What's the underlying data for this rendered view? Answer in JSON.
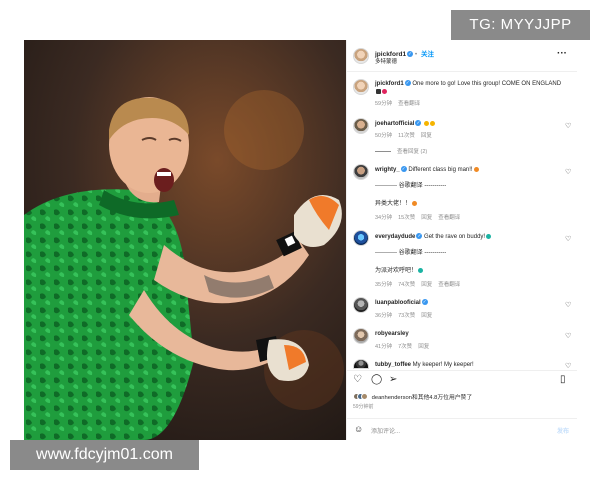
{
  "watermarks": {
    "top": "TG: MYYJJPP",
    "bottom": "www.fdcyjm01.com"
  },
  "post": {
    "author": "jpickford1",
    "follow_label": "关注",
    "subtitle": "多特蒙德",
    "more_icon": "more-horizontal-icon",
    "caption": "One more to go! Love this group! COME ON ENGLAND",
    "caption_time": "59分钟",
    "caption_translate": "查看翻译"
  },
  "comments": [
    {
      "user": "joehartofficial",
      "verified": true,
      "text": "",
      "time": "50分钟",
      "likes": "11次赞",
      "reply": "回复",
      "replies": "查看回复 (2)"
    },
    {
      "user": "wrighty_",
      "verified": true,
      "text": "Different class big man!!",
      "translate_header": "----------- 谷歌翻译 -----------",
      "translation": "异类大佬！！",
      "time": "34分钟",
      "likes": "15次赞",
      "reply": "回复",
      "translate": "查看翻译"
    },
    {
      "user": "everydaydude",
      "verified": true,
      "text": "Get the rave on buddy!",
      "translate_header": "----------- 谷歌翻译 -----------",
      "translation": "为派对欢呼吧！",
      "time": "35分钟",
      "likes": "74次赞",
      "reply": "回复",
      "translate": "查看翻译"
    },
    {
      "user": "luanpablooficial",
      "verified": true,
      "text": "",
      "time": "36分钟",
      "likes": "73次赞",
      "reply": "回复"
    },
    {
      "user": "robyearsley",
      "verified": false,
      "text": "",
      "time": "41分钟",
      "likes": "7次赞",
      "reply": "回复"
    },
    {
      "user": "tubby_toffee",
      "verified": false,
      "text": "My keeper! My keeper!"
    }
  ],
  "actions": {
    "like_icon": "heart-icon",
    "comment_icon": "comment-icon",
    "share_icon": "share-icon",
    "save_icon": "bookmark-icon"
  },
  "likes_text": "deanhenderson和其他4.8万位用户赞了",
  "post_time": "59分钟前",
  "comment_input": {
    "placeholder": "添加评论...",
    "post_label": "发布"
  },
  "colors": {
    "link": "#0095f6",
    "verified": "#3897f0",
    "jersey": "#1f9d3d"
  }
}
